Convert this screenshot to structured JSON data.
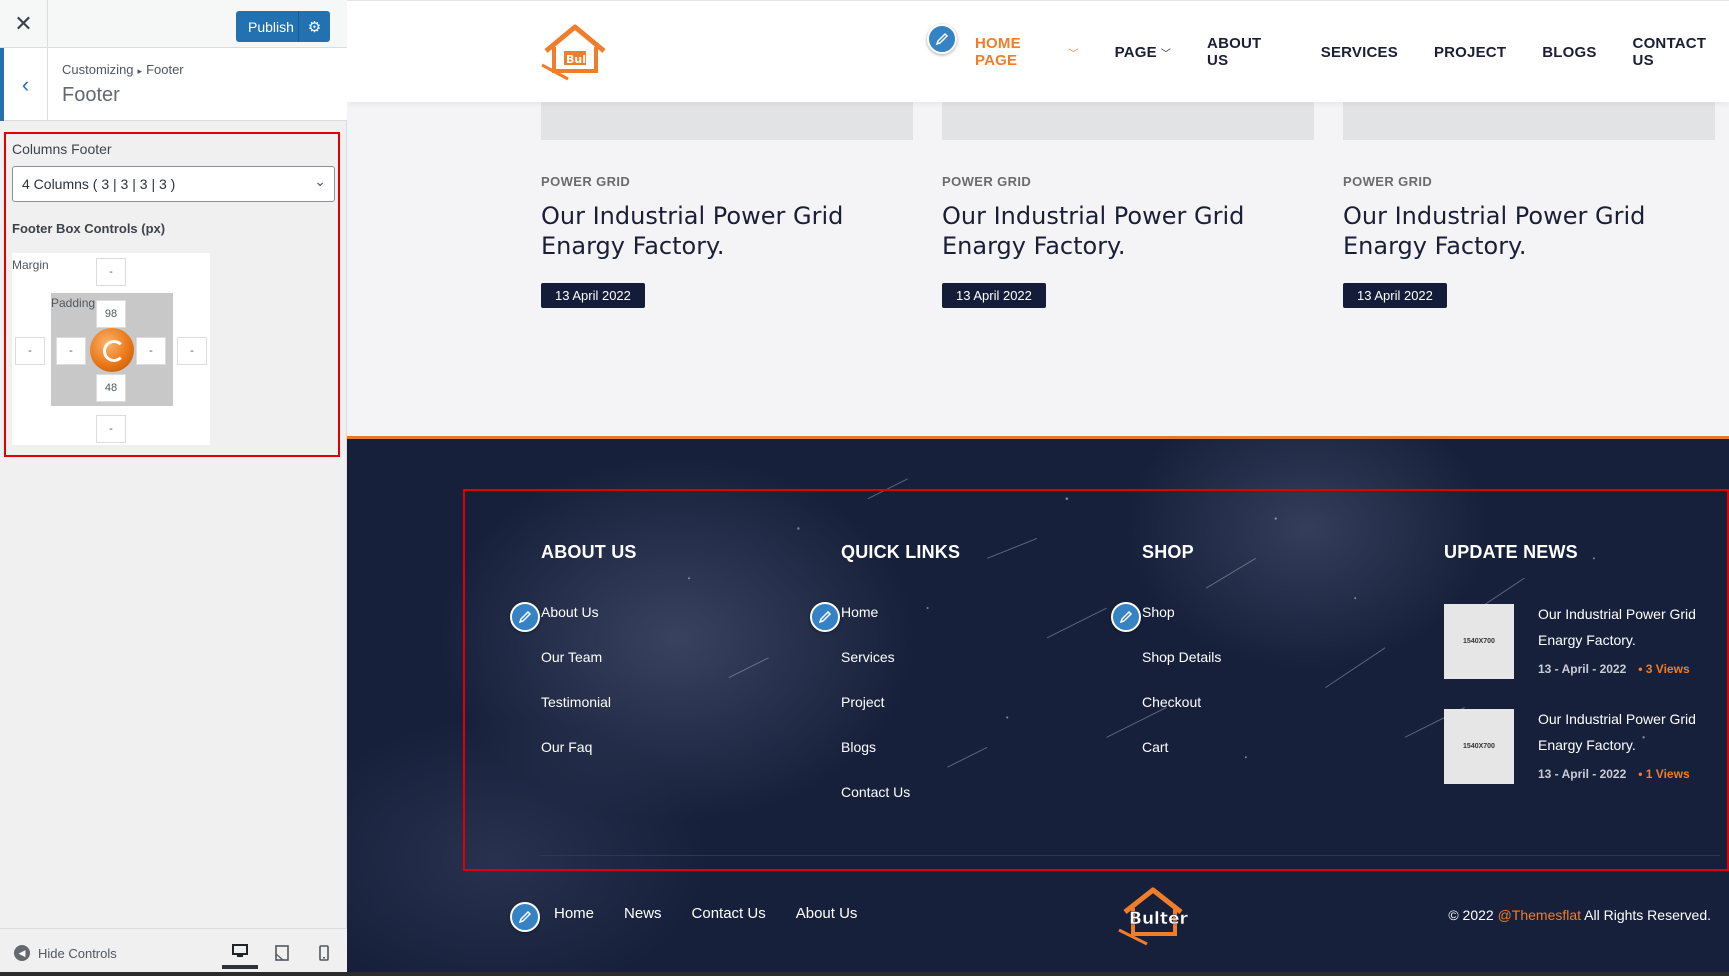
{
  "customizer": {
    "close_icon": "close-icon",
    "publish_label": "Publish",
    "breadcrumb_root": "Customizing",
    "breadcrumb_current": "Footer",
    "section_title": "Footer",
    "columns_footer_label": "Columns Footer",
    "columns_footer_value": "4 Columns ( 3 | 3 | 3 | 3 )",
    "box_controls_label": "Footer Box Controls (px)",
    "margin_label": "Margin",
    "padding_label": "Padding",
    "margin": {
      "top": "-",
      "right": "-",
      "bottom": "-",
      "left": "-"
    },
    "padding": {
      "top": "98",
      "right": "-",
      "bottom": "48",
      "left": "-"
    },
    "hide_controls_label": "Hide Controls",
    "highlight_color": "#e00000",
    "accent": "#2271b1"
  },
  "site": {
    "nav": [
      {
        "label": "HOME PAGE",
        "active": true,
        "dropdown": true
      },
      {
        "label": "PAGE",
        "active": false,
        "dropdown": true
      },
      {
        "label": "ABOUT US",
        "active": false,
        "dropdown": false
      },
      {
        "label": "SERVICES",
        "active": false,
        "dropdown": false
      },
      {
        "label": "PROJECT",
        "active": false,
        "dropdown": false
      },
      {
        "label": "BLOGS",
        "active": false,
        "dropdown": false
      },
      {
        "label": "CONTACT US",
        "active": false,
        "dropdown": false
      }
    ],
    "posts": [
      {
        "category": "POWER GRID",
        "title": "Our Industrial Power Grid Enargy Factory.",
        "date": "13 April 2022"
      },
      {
        "category": "POWER GRID",
        "title": "Our Industrial Power Grid Enargy Factory.",
        "date": "13 April 2022"
      },
      {
        "category": "POWER GRID",
        "title": "Our Industrial Power Grid Enargy Factory.",
        "date": "13 April 2022"
      }
    ],
    "footer": {
      "columns": [
        {
          "title": "ABOUT US",
          "links": [
            "About Us",
            "Our Team",
            "Testimonial",
            "Our Faq"
          ]
        },
        {
          "title": "QUICK LINKS",
          "links": [
            "Home",
            "Services",
            "Project",
            "Blogs",
            "Contact Us"
          ]
        },
        {
          "title": "SHOP",
          "links": [
            "Shop",
            "Shop Details",
            "Checkout",
            "Cart"
          ]
        }
      ],
      "news_title": "UPDATE NEWS",
      "news": [
        {
          "thumb": "1540X700",
          "title": "Our Industrial Power Grid Enargy Factory.",
          "date": "13 - April - 2022",
          "views": "• 3 Views"
        },
        {
          "thumb": "1540X700",
          "title": "Our Industrial Power Grid Enargy Factory.",
          "date": "13 - April - 2022",
          "views": "• 1 Views"
        }
      ],
      "bottom_links": [
        "Home",
        "News",
        "Contact Us",
        "About Us"
      ],
      "copyright_prefix": "© 2022 ",
      "copyright_brand": "@Themesflat",
      "copyright_suffix": " All Rights Reserved.",
      "brand_color": "#f07d2a",
      "logo_text": "Bulter"
    }
  }
}
